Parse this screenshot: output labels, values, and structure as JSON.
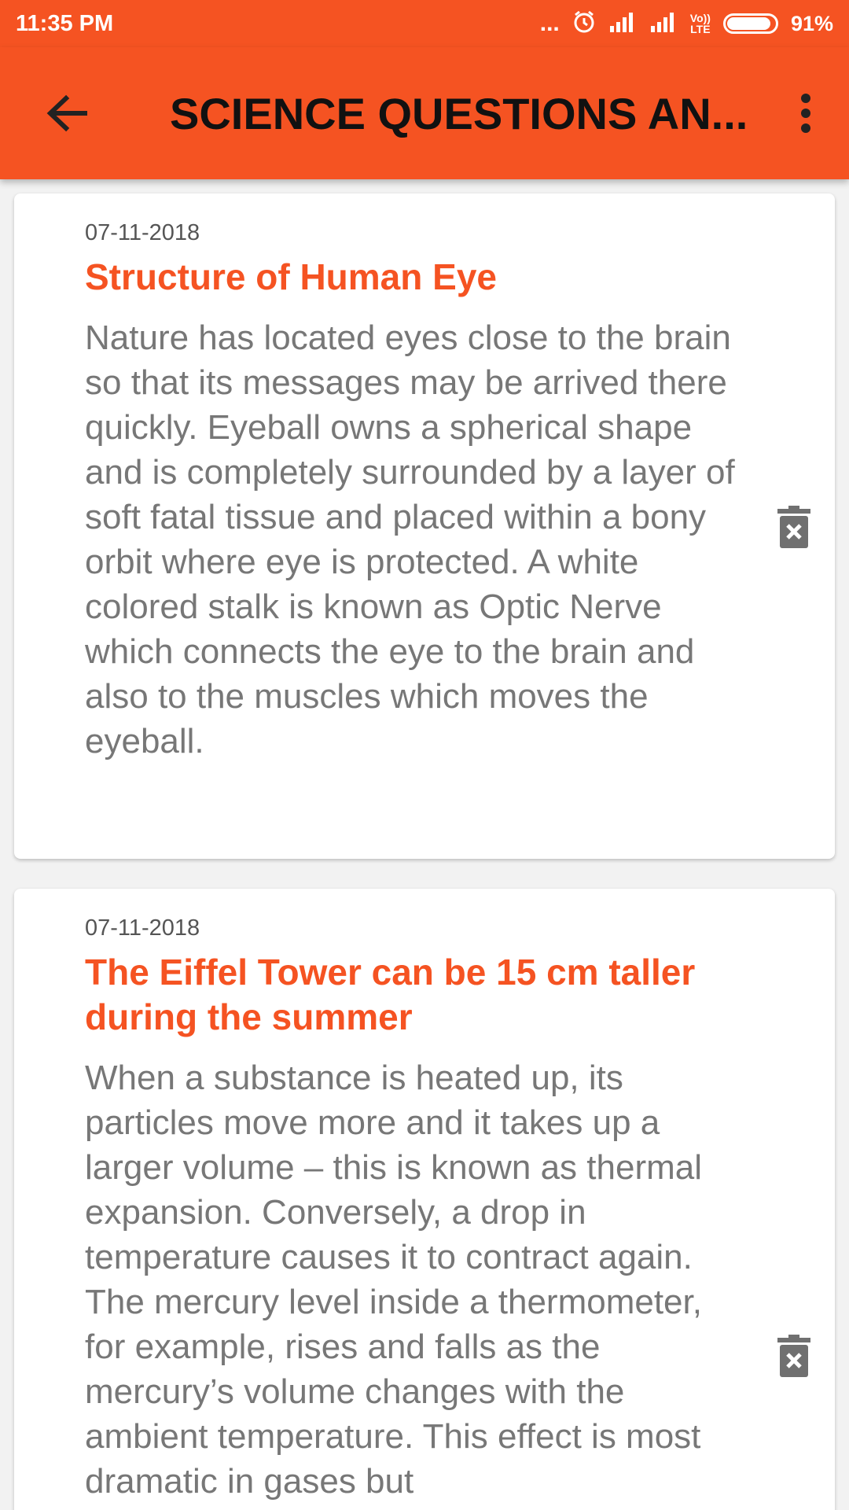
{
  "status_bar": {
    "time": "11:35 PM",
    "dots": "...",
    "network_label_top": "Vo))",
    "network_label_bottom": "LTE",
    "battery_percent": "91%",
    "battery_level": 0.91
  },
  "app_bar": {
    "title": "SCIENCE QUESTIONS AN..."
  },
  "colors": {
    "accent": "#f55322",
    "title_text": "#111111",
    "body_text": "#777777",
    "icon_gray": "#707070"
  },
  "cards": [
    {
      "date": "07-11-2018",
      "title": "Structure of Human Eye",
      "body": "Nature has located eyes close to the brain so that its messages may be arrived there quickly. Eyeball owns a spherical shape and is completely surrounded by a layer of soft fatal tissue and placed within a bony orbit where eye is protected. A white colored stalk is known as Optic Nerve which connects the eye to the brain and also to the muscles which moves the eyeball."
    },
    {
      "date": "07-11-2018",
      "title": "The Eiffel Tower can be 15 cm taller during the summer",
      "body": "When a substance is heated up, its particles move more and it takes up a larger volume – this is known as thermal expansion. Conversely, a drop in temperature causes it to contract again. The mercury level inside a thermometer, for example, rises and falls as the mercury’s volume changes with the ambient temperature. This effect is most dramatic in gases but"
    }
  ]
}
